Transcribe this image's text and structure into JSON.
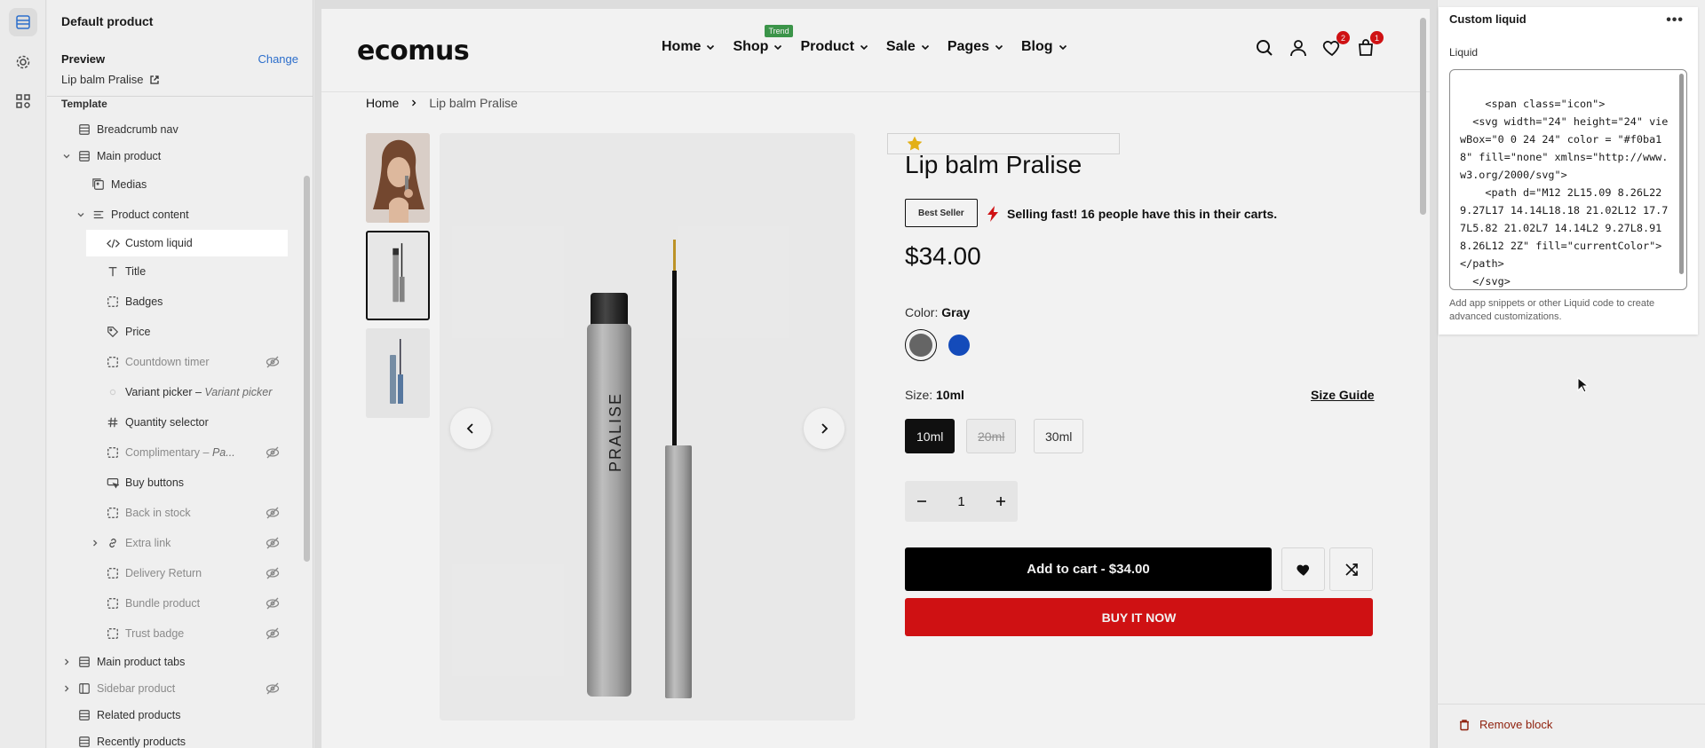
{
  "sidebar": {
    "title": "Default product",
    "preview_label": "Preview",
    "change_label": "Change",
    "preview_product": "Lip balm Pralise",
    "template_label": "Template",
    "items": [
      {
        "label": "Breadcrumb nav"
      },
      {
        "label": "Main product"
      },
      {
        "label": "Medias"
      },
      {
        "label": "Product content"
      },
      {
        "label": "Custom liquid"
      },
      {
        "label": "Title"
      },
      {
        "label": "Badges"
      },
      {
        "label": "Price"
      },
      {
        "label": "Countdown timer"
      },
      {
        "label": "Variant picker",
        "sub": "Variant picker"
      },
      {
        "label": "Quantity selector"
      },
      {
        "label": "Complimentary",
        "sub": "Pa..."
      },
      {
        "label": "Buy buttons"
      },
      {
        "label": "Back in stock"
      },
      {
        "label": "Extra link"
      },
      {
        "label": "Delivery Return"
      },
      {
        "label": "Bundle product"
      },
      {
        "label": "Trust badge"
      },
      {
        "label": "Main product tabs"
      },
      {
        "label": "Sidebar product"
      },
      {
        "label": "Related products"
      },
      {
        "label": "Recently products"
      }
    ]
  },
  "store": {
    "logo": "ecomus",
    "nav": [
      "Home",
      "Shop",
      "Product",
      "Sale",
      "Pages",
      "Blog"
    ],
    "trend_badge": "Trend",
    "wishlist_count": "2",
    "cart_count": "1",
    "breadcrumb": {
      "home": "Home",
      "current": "Lip balm Pralise"
    }
  },
  "product": {
    "title": "Lip balm Pralise",
    "badge": "Best Seller",
    "selling_text": "Selling fast! 16 people have this in their carts.",
    "price": "$34.00",
    "color_label": "Color:",
    "color_value": "Gray",
    "size_label": "Size:",
    "size_value": "10ml",
    "size_guide": "Size Guide",
    "sizes": [
      "10ml",
      "20ml",
      "30ml"
    ],
    "quantity": "1",
    "add_to_cart": "Add to cart - $34.00",
    "buy_now": "BUY IT NOW",
    "tube_brand": "PRALISE",
    "colors": {
      "swatch_gray": "#6b6b6b",
      "swatch_blue": "#1650c4",
      "accent_red": "#db1215"
    }
  },
  "panel": {
    "title": "Custom liquid",
    "field_label": "Liquid",
    "code": "<span class=\"icon\">\n  <svg width=\"24\" height=\"24\" viewBox=\"0 0 24 24\" color = \"#f0ba18\" fill=\"none\" xmlns=\"http://www.w3.org/2000/svg\">\n    <path d=\"M12 2L15.09 8.26L22 9.27L17 14.14L18.18 21.02L12 17.77L5.82 21.02L7 14.14L2 9.27L8.91 8.26L12 2Z\" fill=\"currentColor\"></path>\n  </svg>",
    "help": "Add app snippets or other Liquid code to create advanced customizations.",
    "remove": "Remove block"
  }
}
